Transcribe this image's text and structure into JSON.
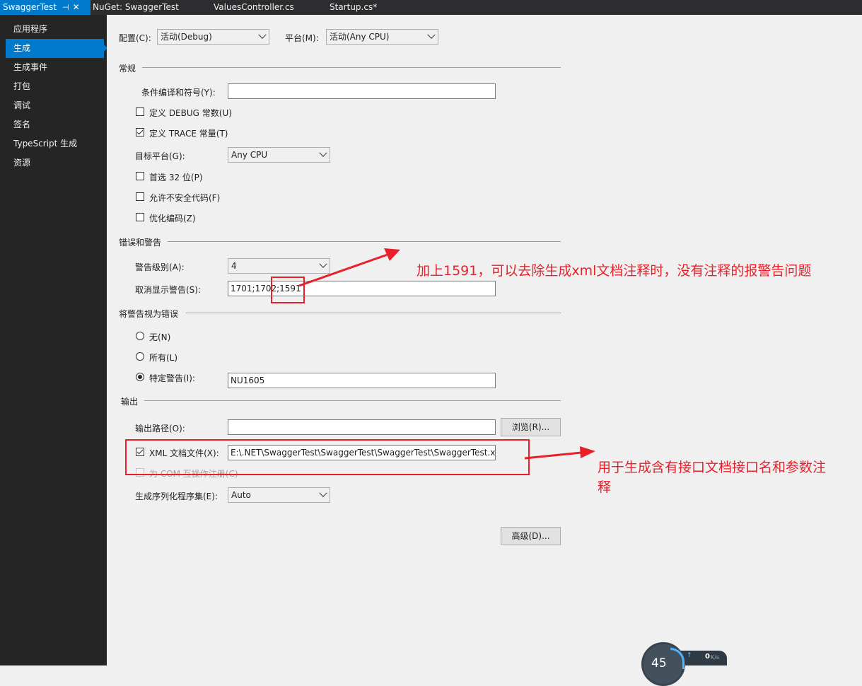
{
  "tabs": [
    {
      "label": "SwaggerTest",
      "active": true
    },
    {
      "label": "NuGet: SwaggerTest",
      "active": false
    },
    {
      "label": "ValuesController.cs",
      "active": false
    },
    {
      "label": "Startup.cs*",
      "active": false
    }
  ],
  "sidebar": {
    "items": [
      "应用程序",
      "生成",
      "生成事件",
      "打包",
      "调试",
      "签名",
      "TypeScript 生成",
      "资源"
    ],
    "selected": "生成"
  },
  "config": {
    "config_label": "配置(C):",
    "config_value": "活动(Debug)",
    "platform_label": "平台(M):",
    "platform_value": "活动(Any CPU)"
  },
  "general": {
    "header": "常规",
    "conditional_label": "条件编译和符号(Y):",
    "conditional_value": "",
    "define_debug_label": "定义 DEBUG 常数(U)",
    "define_debug_checked": false,
    "define_trace_label": "定义 TRACE 常量(T)",
    "define_trace_checked": true,
    "target_label": "目标平台(G):",
    "target_value": "Any CPU",
    "prefer32_label": "首选 32 位(P)",
    "unsafe_label": "允许不安全代码(F)",
    "optimize_label": "优化编码(Z)"
  },
  "errors": {
    "header": "错误和警告",
    "level_label": "警告级别(A):",
    "level_value": "4",
    "suppress_label": "取消显示警告(S):",
    "suppress_value": "1701;1702;1591"
  },
  "treat": {
    "header": "将警告视为错误",
    "none_label": "无(N)",
    "all_label": "所有(L)",
    "specific_label": "特定警告(I):",
    "specific_value": "NU1605",
    "selected": "specific"
  },
  "output": {
    "header": "输出",
    "path_label": "输出路径(O):",
    "path_value": "",
    "browse_label": "浏览(R)...",
    "xml_label": "XML 文档文件(X):",
    "xml_checked": true,
    "xml_value": "E:\\.NET\\SwaggerTest\\SwaggerTest\\SwaggerTest\\SwaggerTest.xml",
    "com_label": "为 COM 互操作注册(C)",
    "serialization_label": "生成序列化程序集(E):",
    "serialization_value": "Auto",
    "advanced_label": "高级(D)..."
  },
  "annotations": {
    "note1": "加上1591，可以去除生成xml文档注释时，没有注释的报警告问题",
    "note2_line1": "用于生成含有接口文档接口名和参数注",
    "note2_line2": "释",
    "color": "#e8202a"
  },
  "widget": {
    "value": "45",
    "speed": "0",
    "unit": "K/s"
  },
  "colors": {
    "accent": "#007acc",
    "sidebar_bg": "#252526",
    "content_bg": "#f0f0f0"
  }
}
